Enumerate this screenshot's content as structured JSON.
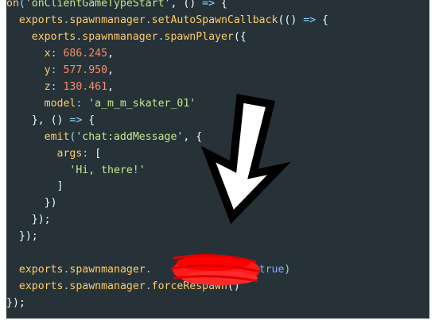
{
  "editor": {
    "lines": [
      {
        "indent": 0,
        "tokens": [
          {
            "t": "on",
            "c": "t-keyword"
          },
          {
            "t": "(",
            "c": "t-punct"
          },
          {
            "t": "'onClientGameTypeStart'",
            "c": "t-string"
          },
          {
            "t": ", () ",
            "c": "t-plain"
          },
          {
            "t": "=>",
            "c": "t-punct"
          },
          {
            "t": " {",
            "c": "t-plain"
          }
        ]
      },
      {
        "indent": 1,
        "tokens": [
          {
            "t": "exports",
            "c": "t-keyword"
          },
          {
            "t": ".",
            "c": "t-punct"
          },
          {
            "t": "spawnmanager",
            "c": "t-keyword"
          },
          {
            "t": ".",
            "c": "t-punct"
          },
          {
            "t": "setAutoSpawnCallback",
            "c": "t-keyword"
          },
          {
            "t": "(() ",
            "c": "t-plain"
          },
          {
            "t": "=>",
            "c": "t-punct"
          },
          {
            "t": " {",
            "c": "t-plain"
          }
        ]
      },
      {
        "indent": 2,
        "tokens": [
          {
            "t": "exports",
            "c": "t-keyword"
          },
          {
            "t": ".",
            "c": "t-punct"
          },
          {
            "t": "spawnmanager",
            "c": "t-keyword"
          },
          {
            "t": ".",
            "c": "t-punct"
          },
          {
            "t": "spawnPlayer",
            "c": "t-keyword"
          },
          {
            "t": "({",
            "c": "t-plain"
          }
        ]
      },
      {
        "indent": 3,
        "tokens": [
          {
            "t": "x",
            "c": "t-keyword"
          },
          {
            "t": ": ",
            "c": "t-punct"
          },
          {
            "t": "686.245",
            "c": "t-number"
          },
          {
            "t": ",",
            "c": "t-plain"
          }
        ]
      },
      {
        "indent": 3,
        "tokens": [
          {
            "t": "y",
            "c": "t-keyword"
          },
          {
            "t": ": ",
            "c": "t-punct"
          },
          {
            "t": "577.950",
            "c": "t-number"
          },
          {
            "t": ",",
            "c": "t-plain"
          }
        ]
      },
      {
        "indent": 3,
        "tokens": [
          {
            "t": "z",
            "c": "t-keyword"
          },
          {
            "t": ": ",
            "c": "t-punct"
          },
          {
            "t": "130.461",
            "c": "t-number"
          },
          {
            "t": ",",
            "c": "t-plain"
          }
        ]
      },
      {
        "indent": 3,
        "tokens": [
          {
            "t": "model",
            "c": "t-keyword"
          },
          {
            "t": ": ",
            "c": "t-punct"
          },
          {
            "t": "'a_m_m_skater_01'",
            "c": "t-string"
          }
        ]
      },
      {
        "indent": 2,
        "tokens": [
          {
            "t": "}, () ",
            "c": "t-plain"
          },
          {
            "t": "=>",
            "c": "t-punct"
          },
          {
            "t": " {",
            "c": "t-plain"
          }
        ]
      },
      {
        "indent": 3,
        "tokens": [
          {
            "t": "emit",
            "c": "t-keyword"
          },
          {
            "t": "(",
            "c": "t-punct"
          },
          {
            "t": "'chat:addMessage'",
            "c": "t-string"
          },
          {
            "t": ", {",
            "c": "t-plain"
          }
        ]
      },
      {
        "indent": 4,
        "tokens": [
          {
            "t": "args",
            "c": "t-keyword"
          },
          {
            "t": ": ",
            "c": "t-punct"
          },
          {
            "t": "[",
            "c": "t-plain"
          }
        ]
      },
      {
        "indent": 5,
        "tokens": [
          {
            "t": "'Hi, there!'",
            "c": "t-string"
          }
        ]
      },
      {
        "indent": 4,
        "tokens": [
          {
            "t": "]",
            "c": "t-plain"
          }
        ]
      },
      {
        "indent": 3,
        "tokens": [
          {
            "t": "})",
            "c": "t-plain"
          }
        ]
      },
      {
        "indent": 2,
        "tokens": [
          {
            "t": "});",
            "c": "t-plain"
          }
        ]
      },
      {
        "indent": 1,
        "tokens": [
          {
            "t": "});",
            "c": "t-plain"
          }
        ]
      },
      {
        "indent": 0,
        "tokens": []
      },
      {
        "indent": 1,
        "tokens": [
          {
            "t": "exports",
            "c": "t-keyword"
          },
          {
            "t": ".",
            "c": "t-punct"
          },
          {
            "t": "spawnmanager",
            "c": "t-keyword"
          },
          {
            "t": ".",
            "c": "t-punct"
          },
          {
            "t": "                ",
            "c": "t-plain"
          },
          {
            "t": "(",
            "c": "t-punct"
          },
          {
            "t": "true",
            "c": "t-boolean"
          },
          {
            "t": ")",
            "c": "t-punct"
          }
        ]
      },
      {
        "indent": 1,
        "tokens": [
          {
            "t": "exports",
            "c": "t-keyword"
          },
          {
            "t": ".",
            "c": "t-punct"
          },
          {
            "t": "spawnmanager",
            "c": "t-keyword"
          },
          {
            "t": ".",
            "c": "t-punct"
          },
          {
            "t": "forceRespawn",
            "c": "t-keyword"
          },
          {
            "t": "()",
            "c": "t-plain"
          }
        ]
      },
      {
        "indent": 0,
        "tokens": [
          {
            "t": "});",
            "c": "t-plain"
          }
        ]
      }
    ]
  },
  "colors": {
    "background": "#263238",
    "page": "#ffffff",
    "arrow_fill": "#ffffff",
    "arrow_stroke": "#000000",
    "redaction": "#ff0000"
  },
  "annotations": {
    "arrow_icon": "down-arrow-icon",
    "redaction_mark": "red-scribble-redaction"
  }
}
